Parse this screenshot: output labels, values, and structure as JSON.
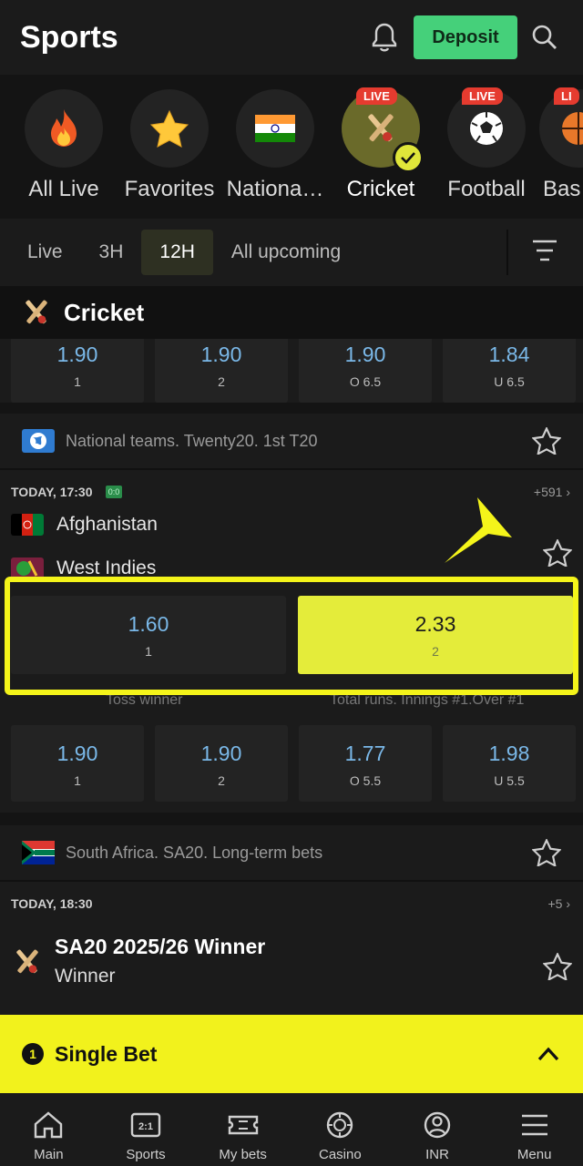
{
  "header": {
    "title": "Sports",
    "deposit_label": "Deposit"
  },
  "sports": [
    {
      "label": "All Live",
      "icon": "fire-icon"
    },
    {
      "label": "Favorites",
      "icon": "star-icon"
    },
    {
      "label": "Nationa…",
      "icon": "india-flag-icon"
    },
    {
      "label": "Cricket",
      "icon": "cricket-icon",
      "live": "LIVE",
      "active": true
    },
    {
      "label": "Football",
      "icon": "football-icon",
      "live": "LIVE"
    },
    {
      "label": "Bas",
      "icon": "basketball-icon",
      "live": "LI"
    }
  ],
  "filters": {
    "live": "Live",
    "h3": "3H",
    "h12": "12H",
    "upcoming": "All upcoming"
  },
  "section": {
    "title": "Cricket"
  },
  "top_odds": [
    {
      "value": "1.90",
      "label": "1"
    },
    {
      "value": "1.90",
      "label": "2"
    },
    {
      "value": "1.90",
      "label": "O 6.5"
    },
    {
      "value": "1.84",
      "label": "U 6.5"
    }
  ],
  "match1": {
    "league": "National teams. Twenty20. 1st T20",
    "time": "TODAY, 17:30",
    "score_badge": "0:0",
    "more": "+591",
    "team1": "Afghanistan",
    "team2": "West Indies",
    "odds_main": [
      {
        "value": "1.60",
        "label": "1"
      },
      {
        "value": "2.33",
        "label": "2"
      }
    ],
    "market_left": "Toss winner",
    "market_right": "Total runs. Innings #1.Over #1",
    "odds_sub": [
      {
        "value": "1.90",
        "label": "1"
      },
      {
        "value": "1.90",
        "label": "2"
      },
      {
        "value": "1.77",
        "label": "O 5.5"
      },
      {
        "value": "1.98",
        "label": "U 5.5"
      }
    ]
  },
  "match2": {
    "league": "South Africa. SA20. Long-term bets",
    "time": "TODAY, 18:30",
    "more": "+5",
    "title": "SA20 2025/26 Winner",
    "subtitle": "Winner"
  },
  "betslip": {
    "count": "1",
    "label": "Single Bet"
  },
  "nav": [
    {
      "label": "Main",
      "icon": "home-icon"
    },
    {
      "label": "Sports",
      "icon": "sports-icon",
      "badge": "2:1"
    },
    {
      "label": "My bets",
      "icon": "ticket-icon"
    },
    {
      "label": "Casino",
      "icon": "casino-chip-icon"
    },
    {
      "label": "INR",
      "icon": "account-icon"
    },
    {
      "label": "Menu",
      "icon": "menu-icon"
    }
  ],
  "colors": {
    "accent": "#f2f21c",
    "deposit": "#45d07a",
    "odds": "#7ab8e8",
    "live": "#e53b2f"
  }
}
